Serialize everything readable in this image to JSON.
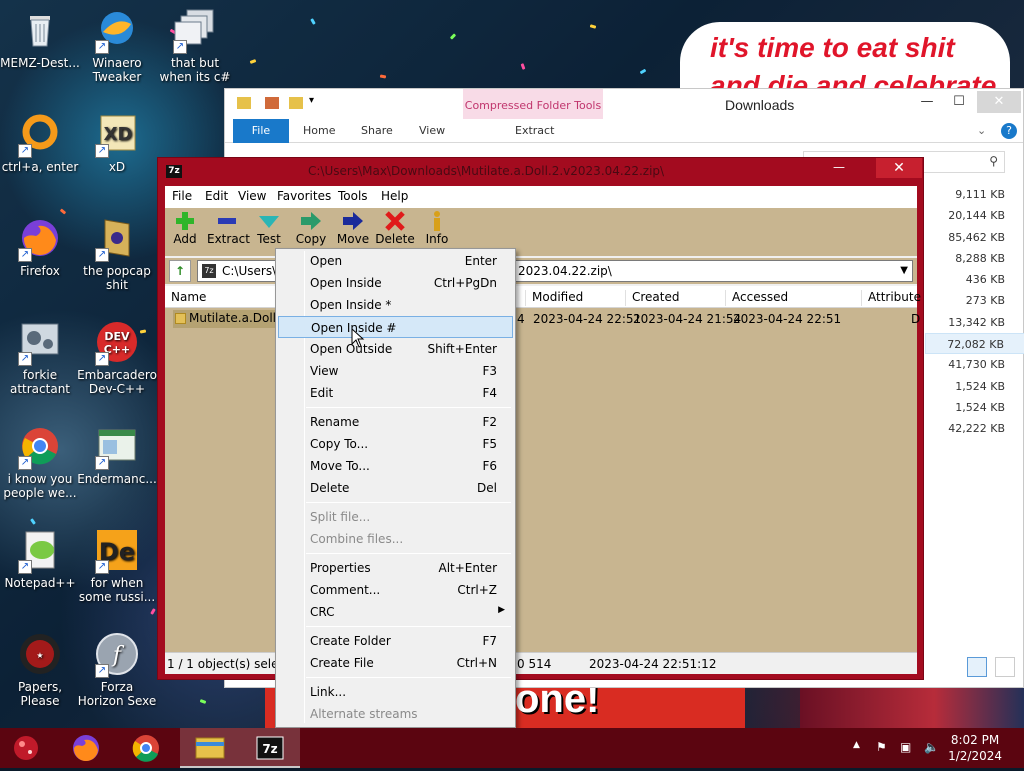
{
  "desktop": {
    "icons": [
      {
        "label": "MEMZ-Dest...",
        "icon": "recycle-bin-icon"
      },
      {
        "label": "Winaero Tweaker",
        "icon": "winaero-icon"
      },
      {
        "label": "that but when its c#",
        "icon": "window-stack-icon"
      },
      {
        "label": "ctrl+a, enter",
        "icon": "orange-ring-icon"
      },
      {
        "label": "xD",
        "icon": "hxd-icon"
      },
      {
        "label": "Firefox",
        "icon": "firefox-icon"
      },
      {
        "label": "the popcap shit",
        "icon": "popcap-icon"
      },
      {
        "label": "forkie attractant",
        "icon": "gears-icon"
      },
      {
        "label": "Embarcadero Dev-C++",
        "icon": "devcpp-icon"
      },
      {
        "label": "i know you people we...",
        "icon": "chrome-icon"
      },
      {
        "label": "Endermanc...",
        "icon": "window-icon"
      },
      {
        "label": "Notepad++",
        "icon": "notepadpp-icon"
      },
      {
        "label": "for when some russi...",
        "icon": "de-icon"
      },
      {
        "label": "Papers, Please",
        "icon": "papers-please-icon"
      },
      {
        "label": "Forza Horizon Sexe",
        "icon": "flash-icon"
      }
    ],
    "meme_line1": "it's time to eat shit",
    "meme_line2": "and die and celebrate",
    "banner_text": "one!"
  },
  "explorer": {
    "title": "Downloads",
    "context_tab": "Compressed Folder Tools",
    "tabs": [
      "File",
      "Home",
      "Share",
      "View"
    ],
    "extract_tab": "Extract",
    "sizes": [
      "9,111 KB",
      "20,144 KB",
      "85,462 KB",
      "8,288 KB",
      "436 KB",
      "273 KB",
      "13,342 KB",
      "72,082 KB",
      "41,730 KB",
      "1,524 KB",
      "1,524 KB",
      "42,222 KB"
    ],
    "selected_size_index": 7
  },
  "sevenzip": {
    "title": "C:\\Users\\Max\\Downloads\\Mutilate.a.Doll.2.v2023.04.22.zip\\",
    "menu": [
      "File",
      "Edit",
      "View",
      "Favorites",
      "Tools",
      "Help"
    ],
    "toolbar": [
      {
        "label": "Add",
        "icon": "plus-icon"
      },
      {
        "label": "Extract",
        "icon": "minus-icon"
      },
      {
        "label": "Test",
        "icon": "check-icon"
      },
      {
        "label": "Copy",
        "icon": "copy-arrow-icon"
      },
      {
        "label": "Move",
        "icon": "move-arrow-icon"
      },
      {
        "label": "Delete",
        "icon": "delete-x-icon"
      },
      {
        "label": "Info",
        "icon": "info-icon"
      }
    ],
    "address_prefix": "C:\\Users\\M",
    "address_suffix": "2023.04.22.zip\\",
    "columns": [
      "Name",
      "Modified",
      "Created",
      "Accessed",
      "Attribute"
    ],
    "row": {
      "name": "Mutilate.a.Doll.2",
      "size_tail": "4",
      "modified": "2023-04-24 22:51",
      "created": "2023-04-24 21:54",
      "accessed": "2023-04-24 22:51",
      "attr": "D"
    },
    "status": {
      "selection": "1 / 1 object(s) selected",
      "size": "0 514",
      "date": "2023-04-24 22:51:12"
    }
  },
  "context_menu": {
    "items": [
      {
        "label": "Open",
        "key": "Enter"
      },
      {
        "label": "Open Inside",
        "key": "Ctrl+PgDn"
      },
      {
        "label": "Open Inside *",
        "key": ""
      },
      {
        "label": "Open Inside #",
        "key": ""
      },
      {
        "label": "Open Outside",
        "key": "Shift+Enter"
      },
      {
        "label": "View",
        "key": "F3"
      },
      {
        "label": "Edit",
        "key": "F4"
      },
      {
        "label": "Rename",
        "key": "F2"
      },
      {
        "label": "Copy To...",
        "key": "F5"
      },
      {
        "label": "Move To...",
        "key": "F6"
      },
      {
        "label": "Delete",
        "key": "Del"
      },
      {
        "label": "Split file...",
        "key": ""
      },
      {
        "label": "Combine files...",
        "key": ""
      },
      {
        "label": "Properties",
        "key": "Alt+Enter"
      },
      {
        "label": "Comment...",
        "key": "Ctrl+Z"
      },
      {
        "label": "CRC",
        "key": ""
      },
      {
        "label": "Create Folder",
        "key": "F7"
      },
      {
        "label": "Create File",
        "key": "Ctrl+N"
      },
      {
        "label": "Link...",
        "key": ""
      },
      {
        "label": "Alternate streams",
        "key": ""
      }
    ],
    "hover_index": 3
  },
  "taskbar": {
    "time": "8:02 PM",
    "date": "1/2/2024",
    "colors": {
      "bar": "#5b0510",
      "accent": "#1979ca"
    }
  }
}
